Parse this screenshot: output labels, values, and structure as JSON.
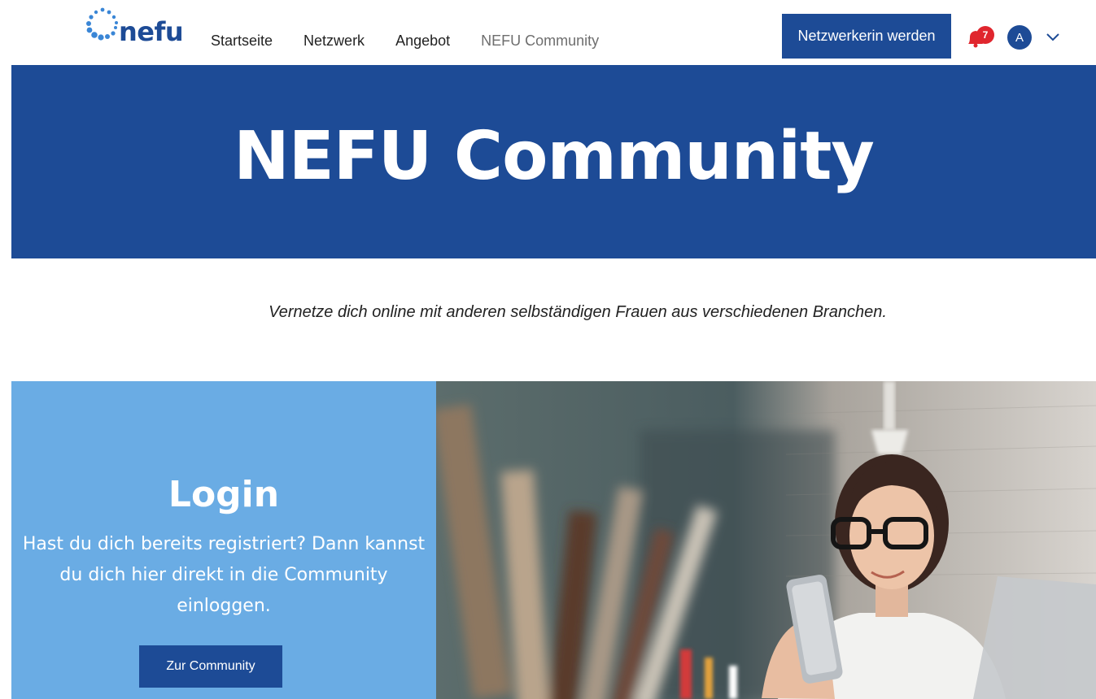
{
  "header": {
    "logo_text": "nefu",
    "nav": [
      {
        "label": "Startseite"
      },
      {
        "label": "Netzwerk"
      },
      {
        "label": "Angebot"
      },
      {
        "label": "NEFU Community"
      }
    ],
    "cta_label": "Netzwerkerin werden",
    "notification_count": "7",
    "avatar_initial": "A"
  },
  "hero": {
    "title": "NEFU Community"
  },
  "intro": {
    "text": "Vernetze dich online mit anderen selbständigen Frauen aus verschiedenen Branchen."
  },
  "login": {
    "title": "Login",
    "text": "Hast du dich bereits registriert? Dann kannst du dich hier direkt in die Community einloggen.",
    "button_label": "Zur Community"
  },
  "colors": {
    "brand_blue": "#1d4b96",
    "light_blue": "#6aace4",
    "badge_red": "#e0262e"
  },
  "icons": [
    "nefu-logo-icon",
    "bell-icon",
    "chevron-down-icon"
  ]
}
